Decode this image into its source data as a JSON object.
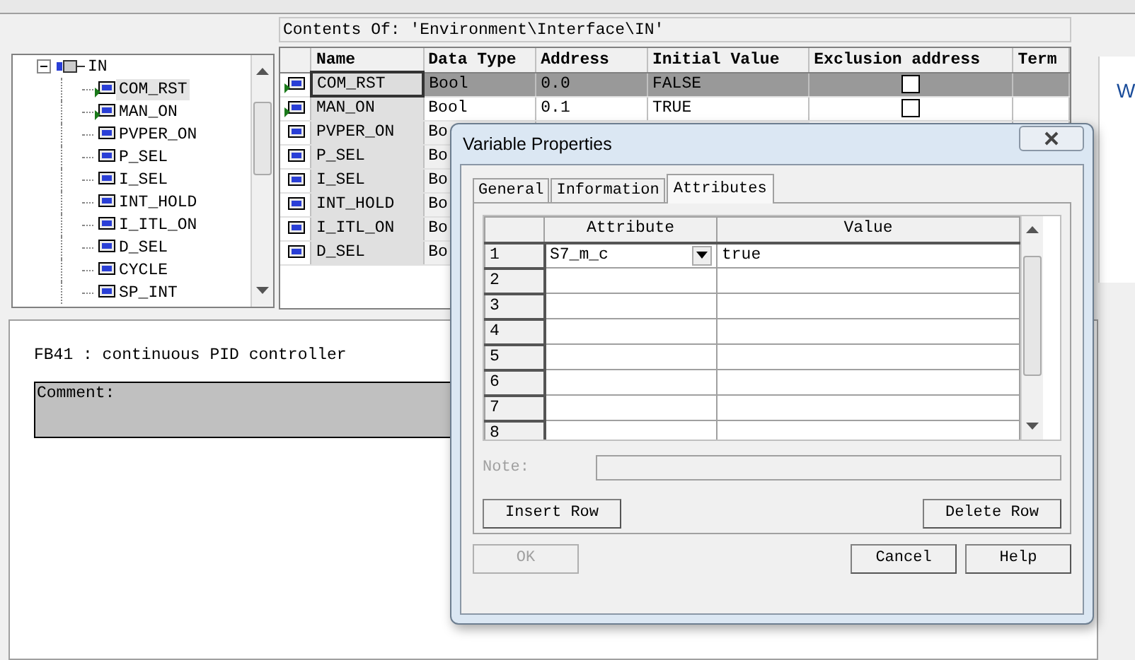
{
  "tree": {
    "root": {
      "label": "IN",
      "expanded": true
    },
    "children": [
      {
        "label": "COM_RST",
        "flagged": true,
        "selected": true
      },
      {
        "label": "MAN_ON",
        "flagged": true,
        "selected": false
      },
      {
        "label": "PVPER_ON",
        "flagged": false,
        "selected": false
      },
      {
        "label": "P_SEL",
        "flagged": false,
        "selected": false
      },
      {
        "label": "I_SEL",
        "flagged": false,
        "selected": false
      },
      {
        "label": "INT_HOLD",
        "flagged": false,
        "selected": false
      },
      {
        "label": "I_ITL_ON",
        "flagged": false,
        "selected": false
      },
      {
        "label": "D_SEL",
        "flagged": false,
        "selected": false
      },
      {
        "label": "CYCLE",
        "flagged": false,
        "selected": false
      },
      {
        "label": "SP_INT",
        "flagged": false,
        "selected": false
      }
    ]
  },
  "contents_path": "Contents Of: 'Environment\\Interface\\IN'",
  "table": {
    "columns": [
      "Name",
      "Data Type",
      "Address",
      "Initial Value",
      "Exclusion address",
      "Term"
    ],
    "rows": [
      {
        "name": "COM_RST",
        "data_type": "Bool",
        "address": "0.0",
        "initial_value": "FALSE",
        "exclusion": false,
        "flagged": true,
        "selected": true
      },
      {
        "name": "MAN_ON",
        "data_type": "Bool",
        "address": "0.1",
        "initial_value": "TRUE",
        "exclusion": false,
        "flagged": true,
        "selected": false
      },
      {
        "name": "PVPER_ON",
        "data_type": "Bo",
        "flagged": false,
        "selected": false
      },
      {
        "name": "P_SEL",
        "data_type": "Bo",
        "flagged": false,
        "selected": false
      },
      {
        "name": "I_SEL",
        "data_type": "Bo",
        "flagged": false,
        "selected": false
      },
      {
        "name": "INT_HOLD",
        "data_type": "Bo",
        "flagged": false,
        "selected": false
      },
      {
        "name": "I_ITL_ON",
        "data_type": "Bo",
        "flagged": false,
        "selected": false
      },
      {
        "name": "D_SEL",
        "data_type": "Bo",
        "flagged": false,
        "selected": false
      }
    ]
  },
  "block_title": "FB41 : continuous PID controller",
  "comment_label": "Comment:",
  "side_text": "W",
  "dialog": {
    "title": "Variable Properties",
    "tabs": [
      {
        "label": "General",
        "selected": false
      },
      {
        "label": "Information",
        "selected": false
      },
      {
        "label": "Attributes",
        "selected": true
      }
    ],
    "grid": {
      "columns": [
        "Attribute",
        "Value"
      ],
      "rows": [
        {
          "number": "1",
          "attribute": "S7_m_c",
          "value": "true"
        },
        {
          "number": "2"
        },
        {
          "number": "3"
        },
        {
          "number": "4"
        },
        {
          "number": "5"
        },
        {
          "number": "6"
        },
        {
          "number": "7"
        },
        {
          "number": "8"
        }
      ]
    },
    "note_label": "Note:",
    "note_disabled": true,
    "grid_buttons": [
      "Insert Row",
      "Delete Row"
    ],
    "buttons": [
      {
        "label": "OK",
        "disabled": true
      },
      {
        "label": "Cancel",
        "disabled": false
      },
      {
        "label": "Help",
        "disabled": false
      }
    ]
  }
}
